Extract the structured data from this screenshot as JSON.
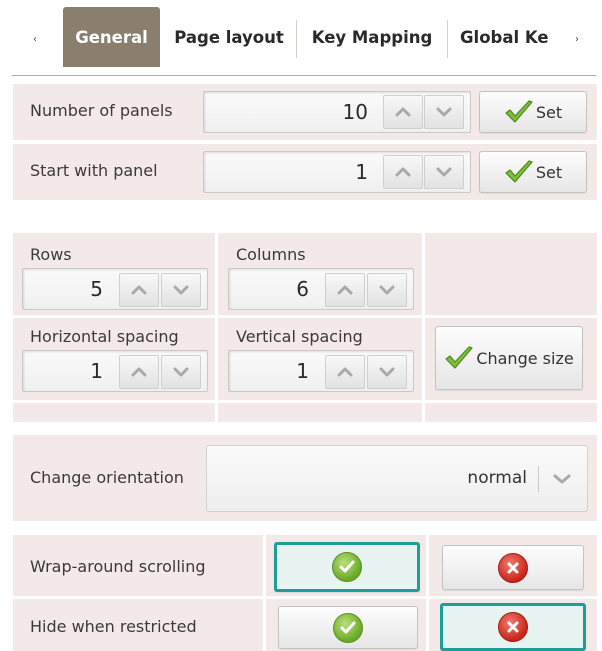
{
  "tabs": {
    "items": [
      {
        "label": "General",
        "active": true
      },
      {
        "label": "Page layout",
        "active": false
      },
      {
        "label": "Key Mapping",
        "active": false
      },
      {
        "label": "Global Ke",
        "active": false
      }
    ],
    "scroll_left": "‹",
    "scroll_right": "›"
  },
  "panels": {
    "number_of_panels": {
      "label": "Number of panels",
      "value": "10",
      "set_label": "Set"
    },
    "start_with_panel": {
      "label": "Start with panel",
      "value": "1",
      "set_label": "Set"
    }
  },
  "grid": {
    "rows": {
      "label": "Rows",
      "value": "5"
    },
    "columns": {
      "label": "Columns",
      "value": "6"
    },
    "horizontal_spacing": {
      "label": "Horizontal spacing",
      "value": "1"
    },
    "vertical_spacing": {
      "label": "Vertical spacing",
      "value": "1"
    },
    "change_size_label": "Change size"
  },
  "orientation": {
    "label": "Change orientation",
    "value": "normal"
  },
  "toggles": {
    "wrap_around": {
      "label": "Wrap-around scrolling",
      "selected": "yes"
    },
    "hide_restricted": {
      "label": "Hide when restricted",
      "selected": "no"
    }
  },
  "colors": {
    "active_tab": "#8a7f6d",
    "panel_bg": "#f3e9e9",
    "selected_border": "#1f9e97",
    "check_green": "#6aa826",
    "cross_red": "#c9251b"
  }
}
